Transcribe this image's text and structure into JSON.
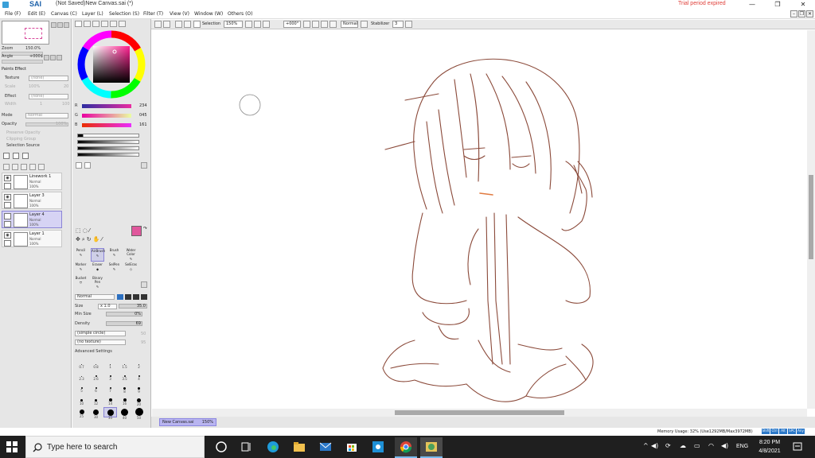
{
  "app": {
    "name": "SAI",
    "title": "(Not Saved)New Canvas.sai (*)",
    "trial_notice": "Trial period expired",
    "window_buttons": [
      "—",
      "❐",
      "✕"
    ],
    "doc_buttons": [
      "–",
      "❐",
      "✕"
    ]
  },
  "menu": [
    "File (F)",
    "Edit (E)",
    "Canvas (C)",
    "Layer (L)",
    "Selection (S)",
    "Filter (T)",
    "View (V)",
    "Window (W)",
    "Others (O)"
  ],
  "navigator": {
    "zoom_label": "Zoom",
    "zoom_value": "150.0%",
    "angle_label": "Angle",
    "angle_value": "+000$"
  },
  "paint_effect": {
    "header": "Paints Effect",
    "texture_label": "Texture",
    "texture_value": "(none)",
    "scale_label": "Scale",
    "scale_value": "100%",
    "scale_num": "20",
    "effect_label": "Effect",
    "effect_value": "(none)",
    "width_label": "Width",
    "width_value": "1",
    "width_num": "100"
  },
  "layer_props": {
    "mode_label": "Mode",
    "mode_value": "Normal",
    "opacity_label": "Opacity",
    "opacity_value": "100%",
    "preserve_opacity": "Preserve Opacity",
    "clipping_group": "Clipping Group",
    "selection_source": "Selection Source"
  },
  "layers": [
    {
      "name": "Linework 1",
      "mode": "Normal",
      "opacity": "100%",
      "selected": false
    },
    {
      "name": "Layer 3",
      "mode": "Normal",
      "opacity": "100%",
      "selected": false
    },
    {
      "name": "Layer 4",
      "mode": "Normal",
      "opacity": "100%",
      "selected": true
    },
    {
      "name": "Layer 1",
      "mode": "Normal",
      "opacity": "100%",
      "selected": false
    }
  ],
  "color": {
    "r_label": "R",
    "r_value": "234",
    "g_label": "G",
    "g_value": "045",
    "b_label": "B",
    "b_value": "161",
    "primary": "#e0579c",
    "secondary": "#7a7a1a"
  },
  "tools": {
    "row1": [
      "Pencil",
      "AirBrush",
      "Brush",
      "Water Color"
    ],
    "row2": [
      "Marker",
      "Eraser",
      "SelPen",
      "SelEras"
    ],
    "row3": [
      "Bucket",
      "Binary Pen"
    ]
  },
  "tool_settings": {
    "blend_mode": "Normal",
    "size_label": "Size",
    "size_mult": "x 1.0",
    "size_value": "35.0",
    "min_size_label": "Min Size",
    "min_size_value": "0%",
    "density_label": "Density",
    "density_value": "69",
    "shape_value": "(simple circle)",
    "shape_num": "50",
    "texture_value": "(no texture)",
    "texture_num": "95",
    "advanced": "Advanced Settings"
  },
  "brush_sizes": [
    [
      "0.7",
      "0.8",
      "1",
      "1.5",
      "2"
    ],
    [
      "2.3",
      "2.6",
      "3",
      "3.5",
      "4"
    ],
    [
      "5",
      "6",
      "7",
      "8",
      "9"
    ],
    [
      "10",
      "12",
      "14",
      "16",
      "20"
    ],
    [
      "25",
      "30",
      "35",
      "40",
      "50"
    ]
  ],
  "canvas_toolbar": {
    "selection_label": "Selection",
    "zoom": "150%",
    "angle": "+000°",
    "blend": "Normal",
    "stabilizer_label": "Stabilizer",
    "stabilizer_value": "3"
  },
  "document_tab": {
    "name": "New Canvas.sai",
    "zoom": "150%"
  },
  "status": {
    "memory": "Memory Usage: 32% (Use1292MB/Max3972MB)",
    "keys": [
      "Shift",
      "Ctrl",
      "Alt",
      "SPC",
      "Any"
    ]
  },
  "taskbar": {
    "search_placeholder": "Type here to search",
    "language": "ENG",
    "time": "8:20 PM",
    "date": "4/8/2021"
  },
  "colors": {
    "layer_selected": "#d6d3f4",
    "line_art": "#8b4a3a",
    "taskbar": "#1f1f1f",
    "trial_red": "#e0403a"
  }
}
